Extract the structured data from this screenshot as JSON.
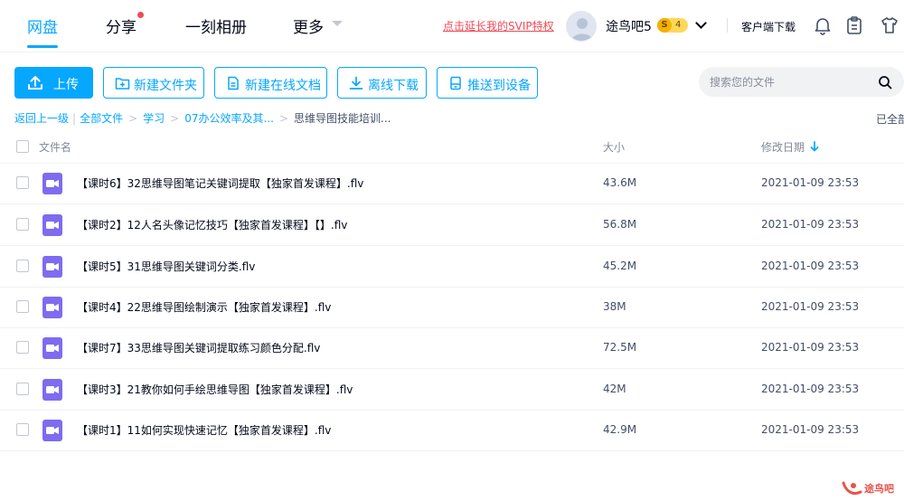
{
  "nav": {
    "items": [
      {
        "label": "网盘",
        "active": true
      },
      {
        "label": "分享",
        "has_dot": true
      },
      {
        "label": "一刻相册"
      },
      {
        "label": "更多",
        "has_caret": true
      }
    ]
  },
  "user": {
    "svip_link": "点击延长我的SVIP特权",
    "name": "途鸟吧5",
    "level_symbol": "S",
    "level": "4",
    "client_download": "客户端下载"
  },
  "toolbar": {
    "upload": "上传",
    "new_folder": "新建文件夹",
    "new_doc": "新建在线文档",
    "offline_download": "离线下载",
    "push_device": "推送到设备"
  },
  "search": {
    "placeholder": "搜索您的文件"
  },
  "breadcrumb": {
    "back": "返回上一级",
    "all_files": "全部文件",
    "study": "学习",
    "office": "07办公效率及其...",
    "current": "思维导图技能培训...",
    "loaded_all": "已全部"
  },
  "table": {
    "col_name": "文件名",
    "col_size": "大小",
    "col_date": "修改日期",
    "rows": [
      {
        "name": "【课时6】32思维导图笔记关键词提取【独家首发课程】.flv",
        "size": "43.6M",
        "date": "2021-01-09 23:53"
      },
      {
        "name": "【课时2】12人名头像记忆技巧【独家首发课程】【】.flv",
        "size": "56.8M",
        "date": "2021-01-09 23:53"
      },
      {
        "name": "【课时5】31思维导图关键词分类.flv",
        "size": "45.2M",
        "date": "2021-01-09 23:53"
      },
      {
        "name": "【课时4】22思维导图绘制演示【独家首发课程】.flv",
        "size": "38M",
        "date": "2021-01-09 23:53"
      },
      {
        "name": "【课时7】33思维导图关键词提取练习颜色分配.flv",
        "size": "72.5M",
        "date": "2021-01-09 23:53"
      },
      {
        "name": "【课时3】21教你如何手绘思维导图【独家首发课程】.flv",
        "size": "42M",
        "date": "2021-01-09 23:53"
      },
      {
        "name": "【课时1】11如何实现快速记忆【独家首发课程】.flv",
        "size": "42.9M",
        "date": "2021-01-09 23:53"
      }
    ]
  },
  "watermark": {
    "text": "途鸟吧"
  },
  "colors": {
    "accent": "#06a7ff",
    "svip": "#f04a54",
    "video_icon": "#7f6bef",
    "badge": "#ffd85a"
  },
  "icons": {
    "bell": "bell-icon",
    "clipboard": "clipboard-icon",
    "tshirt": "tshirt-icon",
    "search": "search-icon",
    "upload": "upload-icon",
    "new_folder": "folder-plus-icon",
    "new_doc": "document-icon",
    "offline_download": "download-icon",
    "push_device": "device-icon",
    "video": "video-file-icon"
  }
}
